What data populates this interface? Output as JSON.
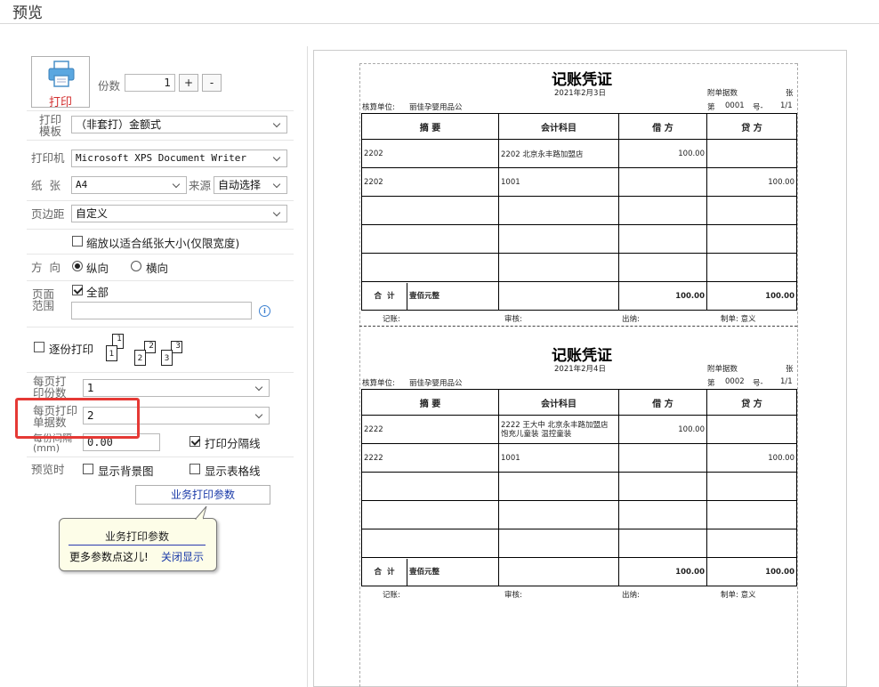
{
  "window": {
    "title": "预览"
  },
  "print": {
    "print_button_label": "打印",
    "copies_label": "份数",
    "copies_value": "1",
    "plus_label": "+",
    "minus_label": "-"
  },
  "settings": {
    "template_label": "打印模板",
    "template_value": "（非套打）金额式",
    "printer_label": "打印机",
    "printer_value": "Microsoft XPS Document Writer",
    "paper_label": "纸  张",
    "paper_value": "A4",
    "source_label": "来源",
    "source_value": "自动选择",
    "margin_label": "页边距",
    "margin_value": "自定义",
    "fit_label": "缩放以适合纸张大小(仅限宽度)",
    "orientation_label": "方  向",
    "portrait_label": "纵向",
    "landscape_label": "横向",
    "range_label": "页面范围",
    "range_all_label": "全部",
    "collate_label": "逐份打印",
    "copies_per_page_label": "每页打印份数",
    "copies_per_page_value": "1",
    "docs_per_page_label": "每页打印单据数",
    "docs_per_page_value": "2",
    "gap_label": "每份间隔(mm)",
    "gap_value": "0.00",
    "separator_label": "打印分隔线",
    "preview_label": "预览时",
    "show_bg_label": "显示背景图",
    "show_grid_label": "显示表格线",
    "business_params_label": "业务打印参数"
  },
  "tooltip": {
    "title": "业务打印参数",
    "body": "更多参数点这儿!",
    "close_link": "关闭显示"
  },
  "collate_icons": [
    "1",
    "2",
    "3",
    "1",
    "2",
    "3"
  ],
  "vouchers": [
    {
      "title": "记账凭证",
      "date": "2021年2月3日",
      "attach_label": "附单据数",
      "attach_unit": "张",
      "unit_label": "核算单位:",
      "unit_value": "丽佳孕婴用品公",
      "voucher_no_label": "第",
      "voucher_no": "0001",
      "no_unit": "号-",
      "page": "1/1",
      "headers": [
        "摘  要",
        "会计科目",
        "借  方",
        "贷  方"
      ],
      "rows": [
        [
          "2202",
          "2202 北京永丰路加盟店",
          "100.00",
          ""
        ],
        [
          "2202",
          "1001",
          "",
          "100.00"
        ],
        [
          "",
          "",
          "",
          ""
        ],
        [
          "",
          "",
          "",
          ""
        ],
        [
          "",
          "",
          "",
          ""
        ]
      ],
      "total_label": "合  计",
      "total_words": "壹佰元整",
      "total_debit": "100.00",
      "total_credit": "100.00",
      "footer": {
        "bookkeeper": "记账:",
        "reviewer": "审核:",
        "cashier": "出纳:",
        "maker": "制单:  意义"
      }
    },
    {
      "title": "记账凭证",
      "date": "2021年2月4日",
      "attach_label": "附单据数",
      "attach_unit": "张",
      "unit_label": "核算单位:",
      "unit_value": "丽佳孕婴用品公",
      "voucher_no_label": "第",
      "voucher_no": "0002",
      "no_unit": "号-",
      "page": "1/1",
      "headers": [
        "摘  要",
        "会计科目",
        "借  方",
        "贷  方"
      ],
      "rows": [
        [
          "2222",
          "2222 王大中 北京永丰路加盟店 饱充儿童装 温控童装",
          "100.00",
          ""
        ],
        [
          "2222",
          "1001",
          "",
          "100.00"
        ],
        [
          "",
          "",
          "",
          ""
        ],
        [
          "",
          "",
          "",
          ""
        ],
        [
          "",
          "",
          "",
          ""
        ]
      ],
      "total_label": "合  计",
      "total_words": "壹佰元整",
      "total_debit": "100.00",
      "total_credit": "100.00",
      "footer": {
        "bookkeeper": "记账:",
        "reviewer": "审核:",
        "cashier": "出纳:",
        "maker": "制单:  意义"
      }
    }
  ]
}
